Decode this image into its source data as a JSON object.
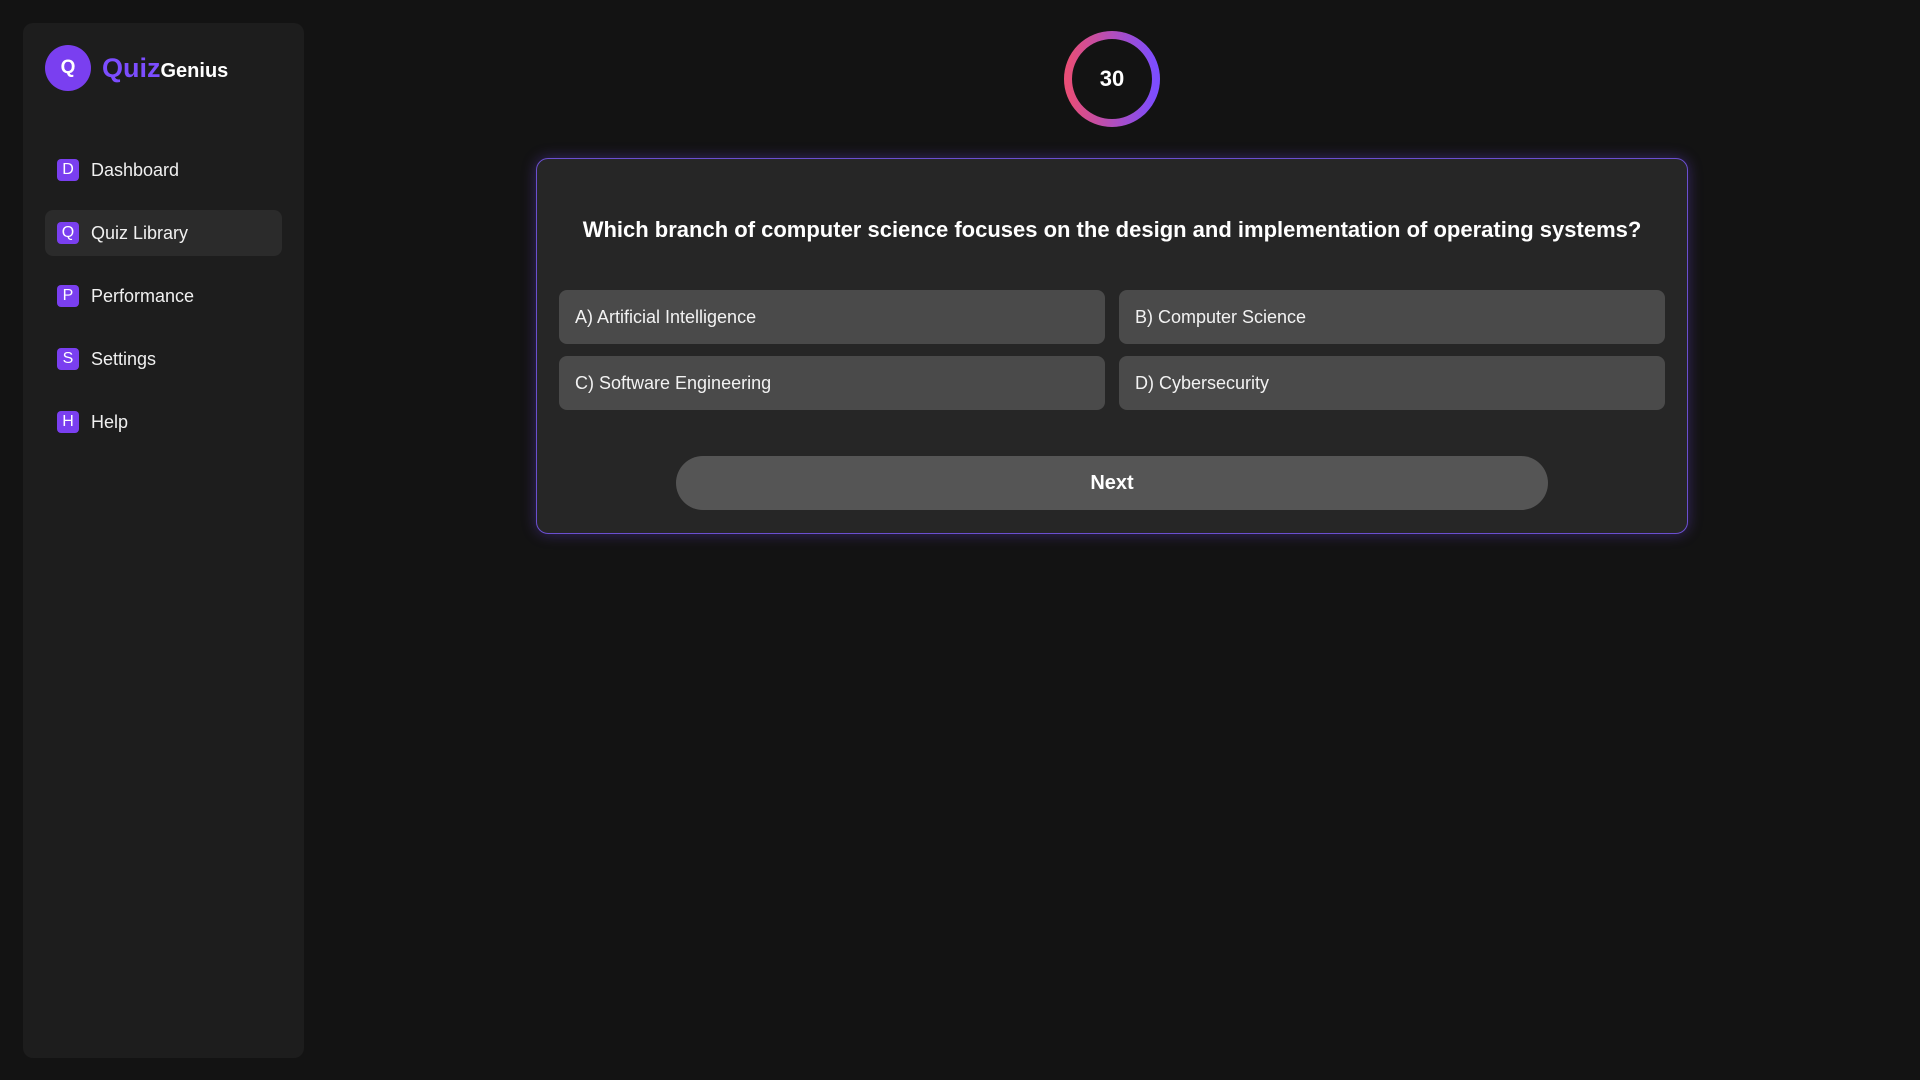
{
  "brand": {
    "avatar_letter": "Q",
    "name_part1": "Quiz",
    "name_part2": "Genius",
    "accent_color": "#7c4dff"
  },
  "sidebar": {
    "items": [
      {
        "icon_letter": "D",
        "icon": "dashboard-icon",
        "label": "Dashboard",
        "active": false
      },
      {
        "icon_letter": "Q",
        "icon": "quiz-library-icon",
        "label": "Quiz Library",
        "active": true
      },
      {
        "icon_letter": "P",
        "icon": "performance-icon",
        "label": "Performance",
        "active": false
      },
      {
        "icon_letter": "S",
        "icon": "settings-icon",
        "label": "Settings",
        "active": false
      },
      {
        "icon_letter": "H",
        "icon": "help-icon",
        "label": "Help",
        "active": false
      }
    ]
  },
  "timer": {
    "value": "30",
    "progress": 1.0,
    "gradient_start": "#e94e77",
    "gradient_end": "#7c4dff"
  },
  "quiz": {
    "question": "Which branch of computer science focuses on the design and implementation of operating systems?",
    "options": [
      {
        "label": "A) Artificial Intelligence"
      },
      {
        "label": "B) Computer Science"
      },
      {
        "label": "C) Software Engineering"
      },
      {
        "label": "D) Cybersecurity"
      }
    ],
    "next_label": "Next"
  }
}
